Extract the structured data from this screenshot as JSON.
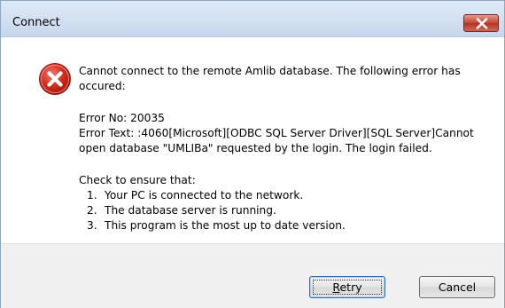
{
  "window": {
    "title": "Connect"
  },
  "message": {
    "main": "Cannot connect to the remote Amlib database.  The following error has",
    "main_cont": "occured:",
    "error_no": "Error No: 20035",
    "error_text_line1": "Error Text: :4060[Microsoft][ODBC SQL Server Driver][SQL Server]Cannot",
    "error_text_line2": "open database \"UMLIBa\" requested by the login. The login failed.",
    "check_heading": "Check to ensure that:",
    "checks": [
      {
        "num": "1.",
        "text": "Your PC is connected to the network."
      },
      {
        "num": "2.",
        "text": "The database server is running."
      },
      {
        "num": "3.",
        "text": "This program is the most up to date version."
      }
    ]
  },
  "buttons": {
    "retry": {
      "accel": "R",
      "rest": "etry"
    },
    "cancel": "Cancel"
  },
  "icons": {
    "error": "error-icon",
    "close": "close-icon"
  },
  "colors": {
    "error_red": "#d42a1e",
    "close_red": "#c44534",
    "titlebar": "#dfeaf7"
  }
}
